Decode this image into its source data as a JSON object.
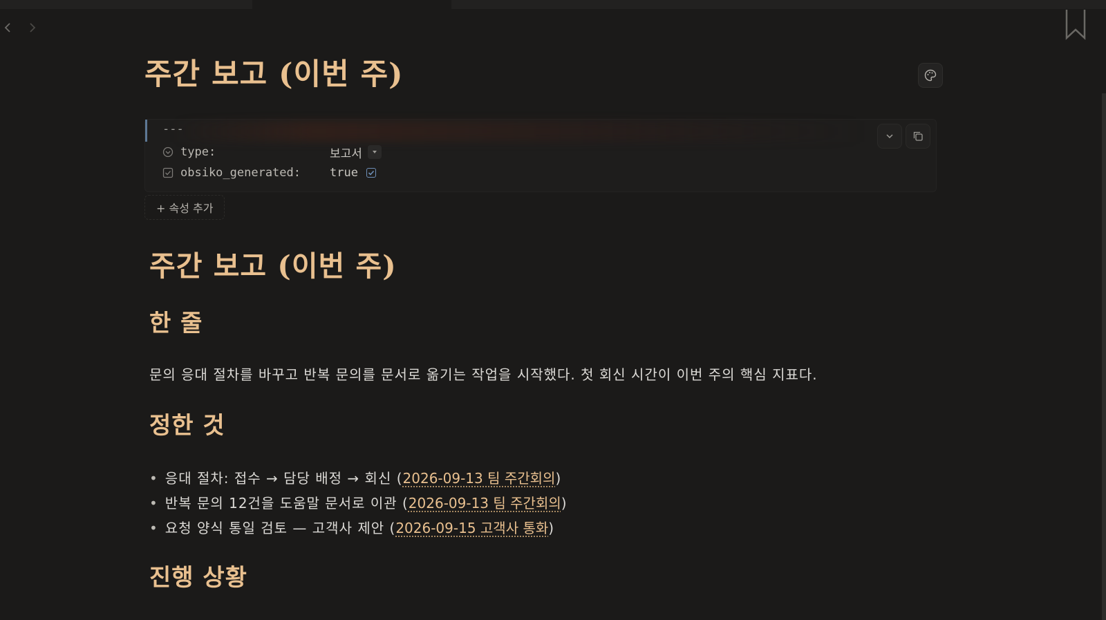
{
  "inline_title": "주간 보고 (이번 주)",
  "properties": {
    "frontmatter_marker": "---",
    "items": [
      {
        "key": "type:",
        "value": "보고서",
        "icon": "list-circle-icon",
        "widget": "dropdown"
      },
      {
        "key": "obsiko_generated:",
        "value": "true",
        "icon": "checkbox-icon",
        "widget": "checkbox",
        "checked": true
      }
    ],
    "add_property_label": "+ 속성 추가"
  },
  "document": {
    "h1": "주간 보고 (이번 주)",
    "section_one_line": {
      "heading": "한 줄",
      "text": "문의 응대 절차를 바꾸고 반복 문의를 문서로 옮기는 작업을 시작했다. 첫 회신 시간이 이번 주의 핵심 지표다."
    },
    "section_decided": {
      "heading": "정한 것",
      "items": [
        {
          "text": "응대 절차: 접수 → 담당 배정 → 회신 (",
          "link": "2026-09-13 팀 주간회의",
          "suffix": ")"
        },
        {
          "text": "반복 문의 12건을 도움말 문서로 이관 (",
          "link": "2026-09-13 팀 주간회의",
          "suffix": ")"
        },
        {
          "text": "요청 양식 통일 검토 — 고객사 제안 (",
          "link": "2026-09-15 고객사 통화",
          "suffix": ")"
        }
      ]
    },
    "section_progress": {
      "heading": "진행 상황"
    }
  },
  "colors": {
    "background": "#1b1a19",
    "heading": "#e9c08f",
    "body_text": "#dcdad6",
    "accent_blue": "#6e8fb8"
  }
}
